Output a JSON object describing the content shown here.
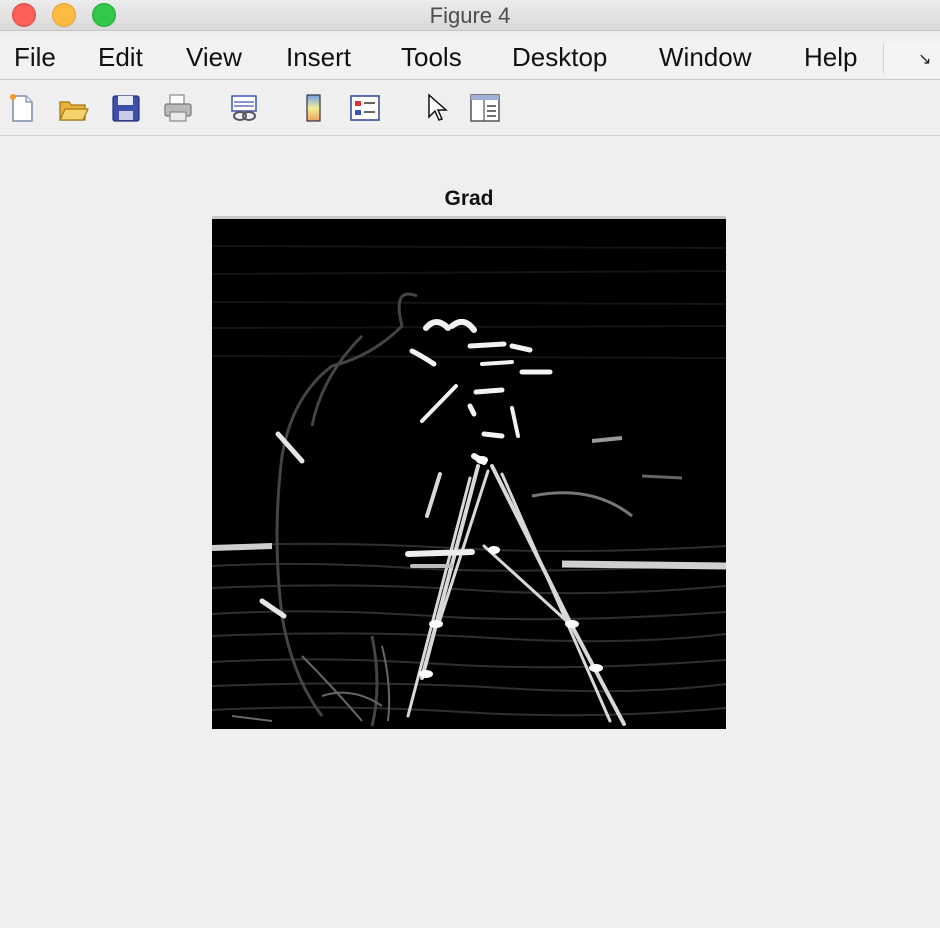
{
  "window": {
    "title": "Figure 4"
  },
  "menu": {
    "items": [
      "File",
      "Edit",
      "View",
      "Insert",
      "Tools",
      "Desktop",
      "Window",
      "Help"
    ]
  },
  "toolbar": {
    "buttons": [
      {
        "icon": "new-figure-icon"
      },
      {
        "icon": "open-file-icon"
      },
      {
        "icon": "save-icon"
      },
      {
        "icon": "print-icon"
      },
      {
        "icon": "link-plot-icon"
      },
      {
        "icon": "colorbar-icon"
      },
      {
        "icon": "legend-icon"
      },
      {
        "icon": "pointer-icon"
      },
      {
        "icon": "property-editor-icon"
      }
    ]
  },
  "figure": {
    "axes_title": "Grad",
    "image_description_colormap": "gray"
  },
  "colors": {
    "background": "#efefef",
    "image_background": "#000000",
    "close": "#fc605b",
    "minimize": "#fdbc40",
    "maximize": "#34c84a"
  }
}
